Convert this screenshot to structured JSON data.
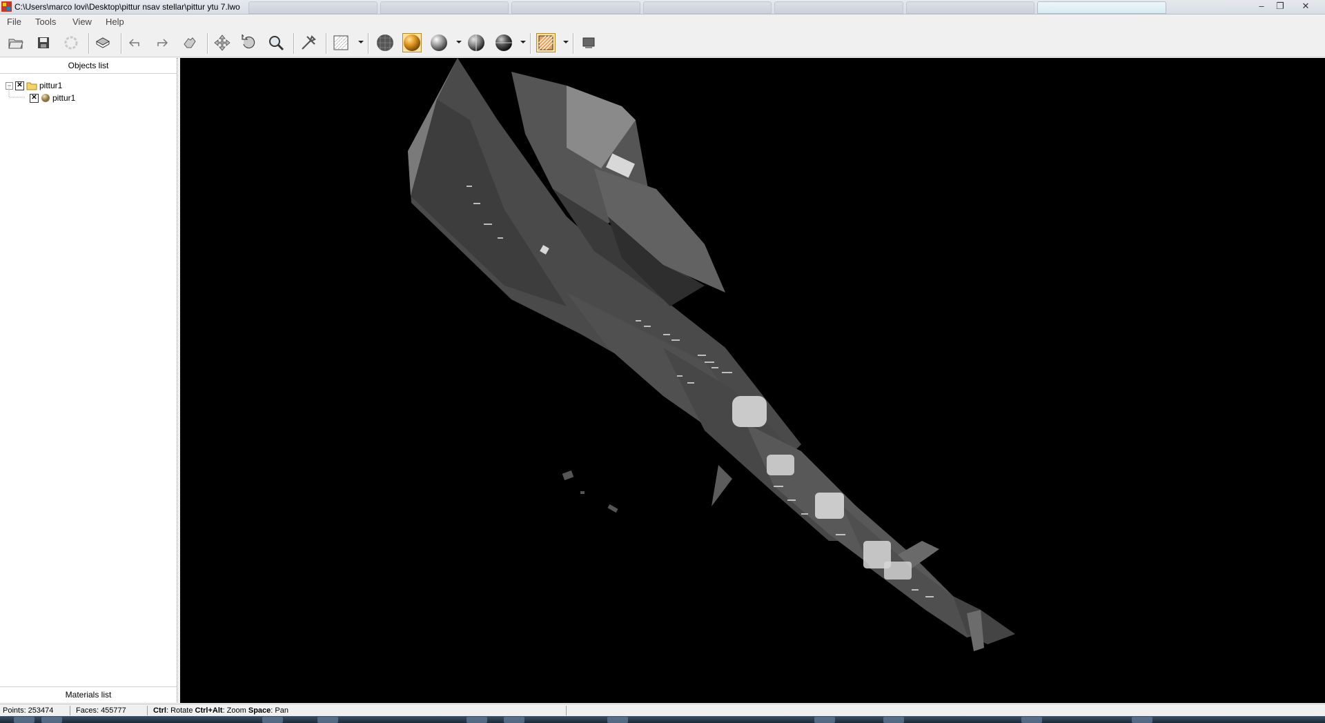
{
  "window": {
    "title": "C:\\Users\\marco lovi\\Desktop\\pittur nsav stellar\\pittur ytu 7.lwo",
    "controls": [
      "–",
      "❐",
      "✕"
    ]
  },
  "menu": {
    "file": "File",
    "tools": "Tools",
    "view": "View",
    "help": "Help"
  },
  "toolbar": {
    "icons": [
      "open-icon",
      "save-icon",
      "reload-icon",
      "render-icon",
      "undo-icon",
      "redo-icon",
      "hand-icon",
      "move-icon",
      "rotate-icon",
      "zoom-icon",
      "tools-icon",
      "grid-icon",
      "wireframe-sphere-icon",
      "smooth-sphere-icon",
      "flat-sphere-icon",
      "half-sphere-icon",
      "dark-sphere-icon",
      "texture-icon",
      "screen-icon"
    ],
    "active": [
      "smooth-sphere-icon",
      "texture-icon"
    ]
  },
  "left_panel": {
    "objects_header": "Objects list",
    "tree": [
      {
        "label": "pittur1",
        "type": "folder",
        "checked": true,
        "expanded": true
      },
      {
        "label": "pittur1",
        "type": "mesh",
        "checked": true
      }
    ],
    "materials_header": "Materials list"
  },
  "status": {
    "points": "Points: 253474",
    "faces": "Faces: 455777",
    "hint_ctrl_key": "Ctrl",
    "hint_ctrl_action": ": Rotate ",
    "hint_ctrlalt_key": "Ctrl+Alt",
    "hint_ctrlalt_action": ": Zoom ",
    "hint_space_key": "Space",
    "hint_space_action": ": Pan"
  },
  "colors": {
    "viewport_bg": "#000000",
    "model_gray": "#5a5a5a",
    "accent_active": "#ffe3a6"
  }
}
